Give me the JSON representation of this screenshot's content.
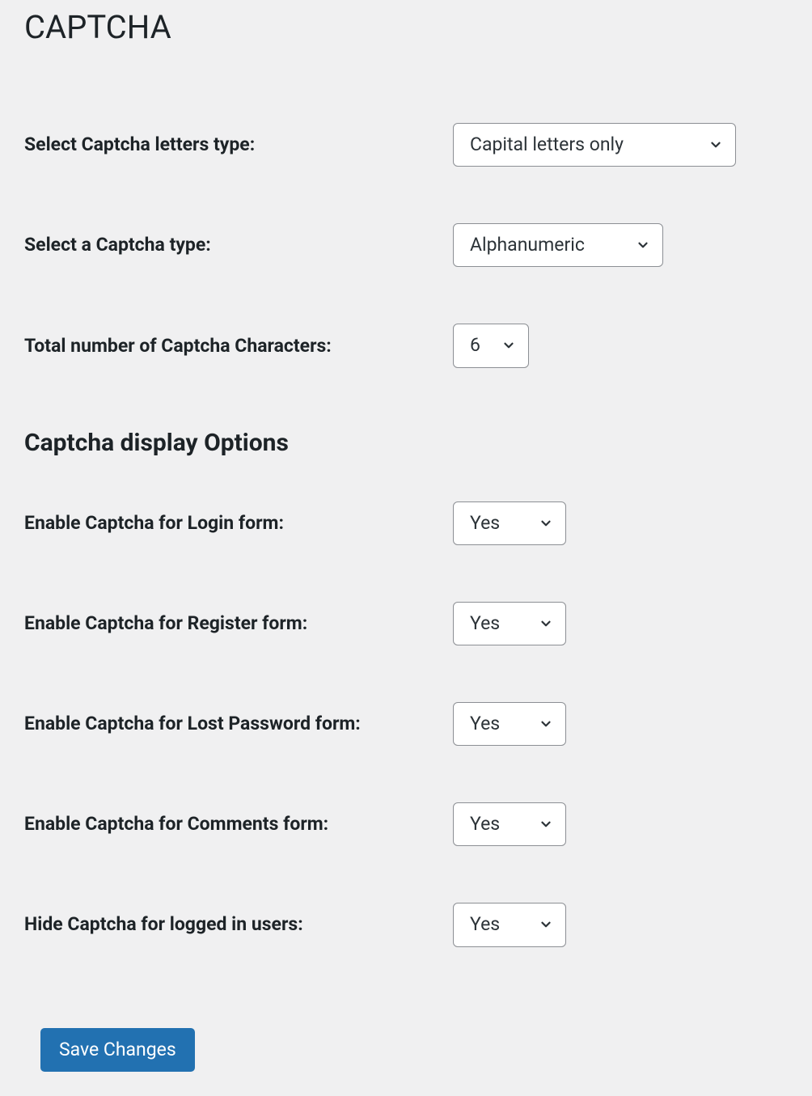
{
  "page": {
    "title": "CAPTCHA",
    "section_display_title": "Captcha display Options",
    "save_button": "Save Changes"
  },
  "fields": {
    "letters_type": {
      "label": "Select Captcha letters type:",
      "value": "Capital letters only"
    },
    "captcha_type": {
      "label": "Select a Captcha type:",
      "value": "Alphanumeric"
    },
    "char_count": {
      "label": "Total number of Captcha Characters:",
      "value": "6"
    },
    "login": {
      "label": "Enable Captcha for Login form:",
      "value": "Yes"
    },
    "register": {
      "label": "Enable Captcha for Register form:",
      "value": "Yes"
    },
    "lost_password": {
      "label": "Enable Captcha for Lost Password form:",
      "value": "Yes"
    },
    "comments": {
      "label": "Enable Captcha for Comments form:",
      "value": "Yes"
    },
    "hide_logged_in": {
      "label": "Hide Captcha for logged in users:",
      "value": "Yes"
    }
  }
}
